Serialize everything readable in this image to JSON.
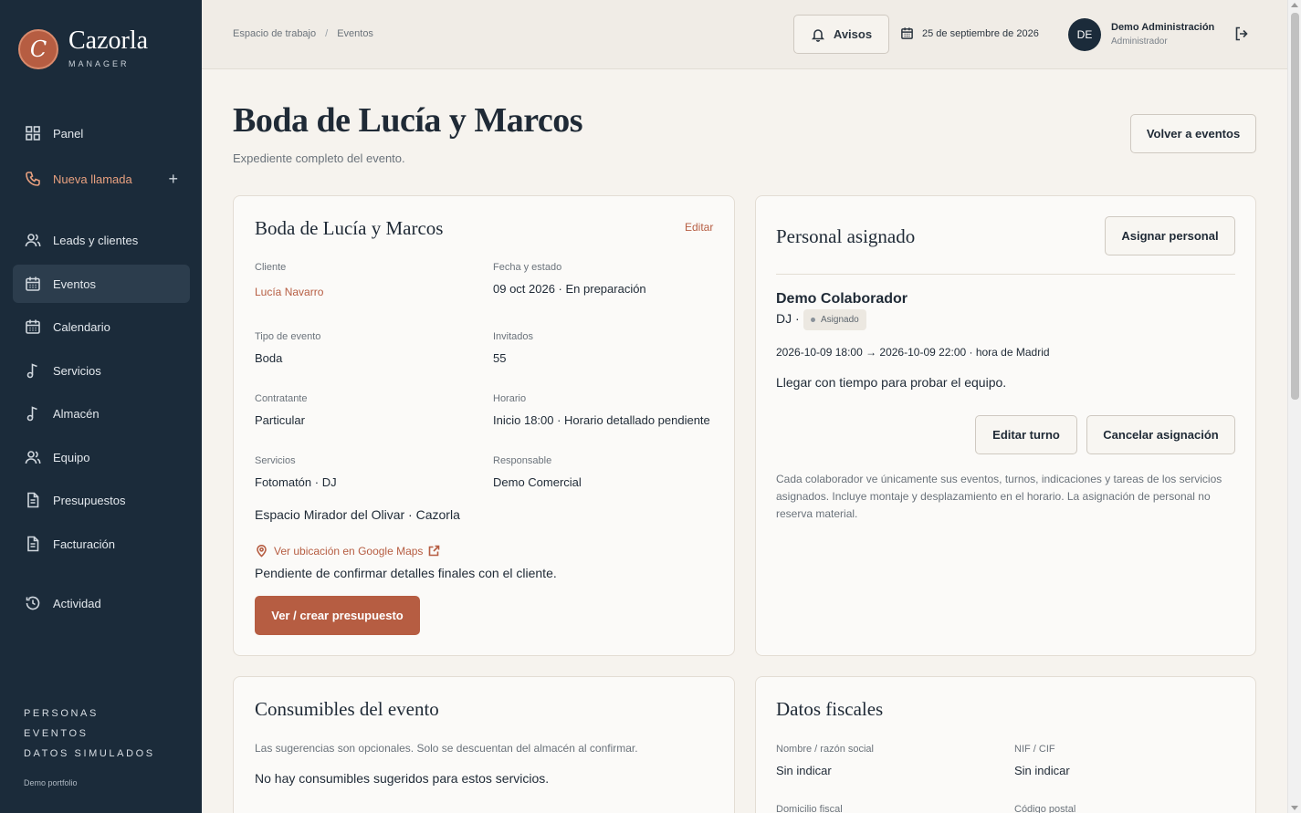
{
  "brand": {
    "logo_letter": "C",
    "name": "Cazorla",
    "sub": "MANAGER"
  },
  "nav": {
    "items": [
      {
        "label": "Panel",
        "icon": "grid-icon"
      },
      {
        "label": "Nueva llamada",
        "icon": "phone-icon",
        "plus": "+"
      },
      {
        "label": "Leads y clientes",
        "icon": "users-icon"
      },
      {
        "label": "Eventos",
        "icon": "calendar-icon"
      },
      {
        "label": "Calendario",
        "icon": "calendar-icon"
      },
      {
        "label": "Servicios",
        "icon": "music-note-icon"
      },
      {
        "label": "Almacén",
        "icon": "music-note-icon"
      },
      {
        "label": "Equipo",
        "icon": "users-icon"
      },
      {
        "label": "Presupuestos",
        "icon": "document-icon"
      },
      {
        "label": "Facturación",
        "icon": "document-icon"
      },
      {
        "label": "Actividad",
        "icon": "history-icon"
      }
    ],
    "footer_links": [
      "PERSONAS",
      "EVENTOS",
      "DATOS SIMULADOS"
    ],
    "footer_note": "Demo portfolio"
  },
  "topbar": {
    "breadcrumb": [
      "Espacio de trabajo",
      "/",
      "Eventos"
    ],
    "avisos": "Avisos",
    "date": "25 de septiembre de 2026",
    "user": {
      "initials": "DE",
      "name": "Demo Administración",
      "role": "Administrador"
    }
  },
  "page": {
    "title": "Boda de Lucía y Marcos",
    "subtitle": "Expediente completo del evento.",
    "back_button": "Volver a eventos"
  },
  "event_card": {
    "title": "Boda de Lucía y Marcos",
    "edit": "Editar",
    "fields": {
      "cliente_label": "Cliente",
      "cliente": "Lucía Navarro",
      "fecha_label": "Fecha y estado",
      "fecha": "09 oct 2026 · En preparación",
      "tipo_label": "Tipo de evento",
      "tipo": "Boda",
      "invitados_label": "Invitados",
      "invitados": "55",
      "contratante_label": "Contratante",
      "contratante": "Particular",
      "horario_label": "Horario",
      "horario": "Inicio 18:00 · Horario detallado pendiente",
      "servicios_label": "Servicios",
      "servicios": "Fotomatón · DJ",
      "responsable_label": "Responsable",
      "responsable": "Demo Comercial"
    },
    "venue": "Espacio Mirador del Olivar · Cazorla",
    "maps_link": "Ver ubicación en Google Maps",
    "notes": "Pendiente de confirmar detalles finales con el cliente.",
    "quote_button": "Ver / crear presupuesto"
  },
  "staff_card": {
    "title": "Personal asignado",
    "assign_button": "Asignar personal",
    "person": "Demo Colaborador",
    "role": "DJ ·",
    "status": "Asignado",
    "shift": "2026-10-09 18:00 → 2026-10-09 22:00 · hora de Madrid",
    "instructions": "Llegar con tiempo para probar el equipo.",
    "edit_shift": "Editar turno",
    "cancel_assignment": "Cancelar asignación",
    "note": "Cada colaborador ve únicamente sus eventos, turnos, indicaciones y tareas de los servicios asignados. Incluye montaje y desplazamiento en el horario. La asignación de personal no reserva material."
  },
  "consumables_card": {
    "title": "Consumibles del evento",
    "hint": "Las sugerencias son opcionales. Solo se descuentan del almacén al confirmar.",
    "empty": "No hay consumibles sugeridos para estos servicios."
  },
  "fiscal_card": {
    "title": "Datos fiscales",
    "name_label": "Nombre / razón social",
    "name": "Sin indicar",
    "nif_label": "NIF / CIF",
    "nif": "Sin indicar",
    "address_label": "Domicilio fiscal",
    "postal_label": "Código postal"
  },
  "colors": {
    "sidebar": "#1b2b3a",
    "accent": "#b65d42",
    "background": "#f6f3ee"
  }
}
